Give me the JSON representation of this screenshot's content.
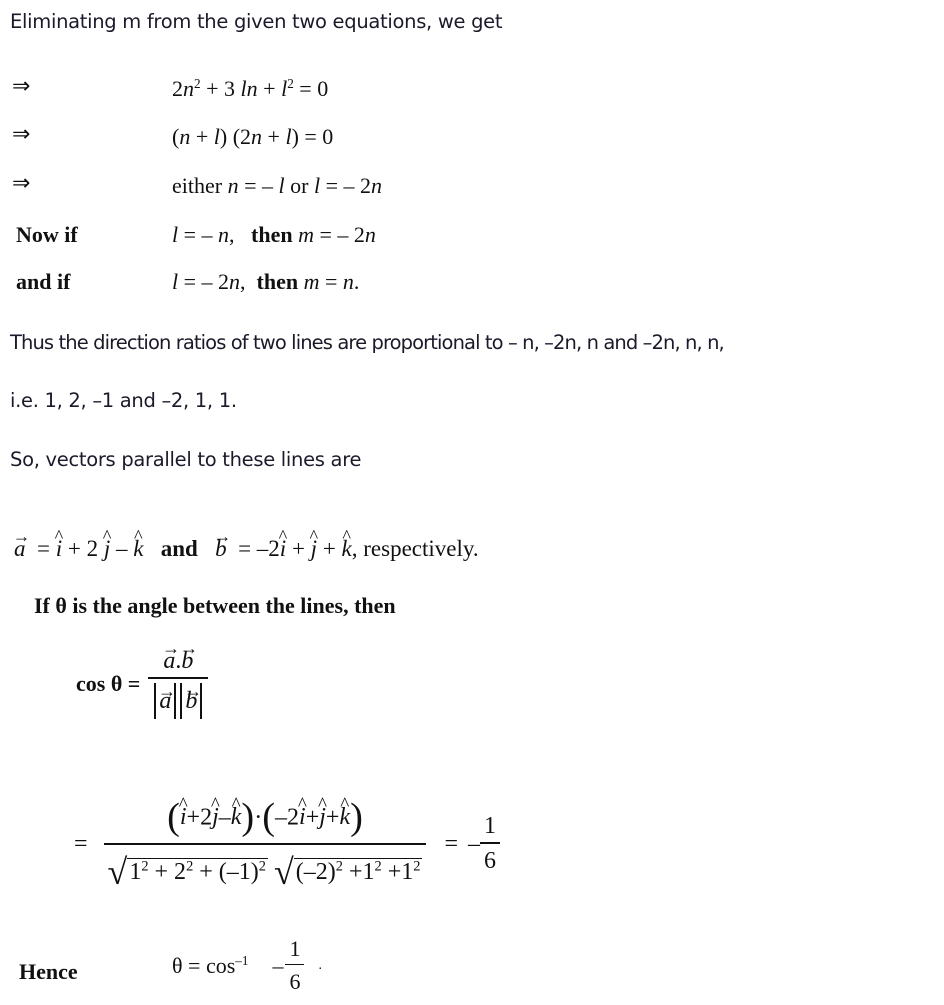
{
  "intro": "Eliminating m from the given two equations, we get",
  "implies_symbol": "⇒",
  "steps": [
    {
      "lead": "⇒",
      "expr": "2n² + 3 ln + l² = 0"
    },
    {
      "lead": "⇒",
      "expr": "(n + l) (2n + l) = 0"
    },
    {
      "lead": "⇒",
      "expr": "either n = – l or l = – 2n"
    }
  ],
  "cases": [
    {
      "lead": "Now if",
      "cond": "l = – n,",
      "then": "then",
      "result": "m = – 2n"
    },
    {
      "lead": "and if",
      "cond": "l = – 2n,",
      "then": "then",
      "result": "m = n."
    }
  ],
  "direction_ratios_text": "Thus the direction ratios of two lines are proportional to – n, –2n, n and –2n, n, n,",
  "ie_text": "i.e. 1, 2, –1 and –2, 1, 1.",
  "vectors_intro": "So, vectors parallel to these lines are",
  "vectors": {
    "a_name": "a",
    "a_expr": "= î + 2ĵ – k̂",
    "and": "and",
    "b_name": "b",
    "b_expr": "= –2î + ĵ + k̂",
    "suffix": ", respectively."
  },
  "angle_intro": "If θ is the angle between the lines, then",
  "cos_formula": {
    "lhs": "cos θ =",
    "numerator": "a . b",
    "denominator": "|a| |b|"
  },
  "cos_value": {
    "eq": "=",
    "numerator_left": "î + 2ĵ – k̂",
    "dot": "·",
    "numerator_right": "–2î + ĵ + k̂",
    "den_left": "1² + 2² + (–1)²",
    "den_right": "(–2)² + 1² + 1²",
    "result_eq": "=",
    "result_sign": "–",
    "result_num": "1",
    "result_den": "6"
  },
  "conclusion": {
    "lead": "Hence",
    "expr": "θ = cos⁻¹",
    "sign": "–",
    "num": "1",
    "den": "6",
    "tail": "."
  }
}
